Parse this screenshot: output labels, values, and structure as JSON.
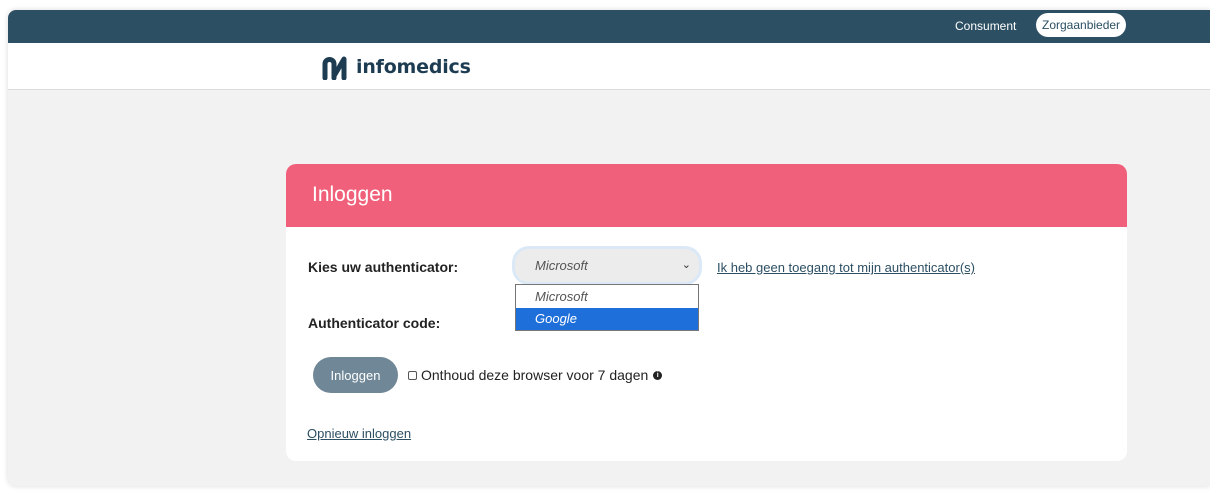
{
  "topnav": {
    "consumer": "Consument",
    "provider": "Zorgaanbieder"
  },
  "brand": {
    "name": "infomedics",
    "color": "#1d3c52"
  },
  "colors": {
    "topbar": "#2c4f63",
    "card_header": "#f0607a",
    "button": "#6f8797",
    "selected_option": "#1e6fd9"
  },
  "login": {
    "title": "Inloggen",
    "authenticator_label": "Kies uw authenticator:",
    "authenticator_selected": "Microsoft",
    "authenticator_options": [
      "Microsoft",
      "Google"
    ],
    "highlighted_option": "Google",
    "no_access_link": "Ik heb geen toegang tot mijn authenticator(s)",
    "code_label": "Authenticator code:",
    "submit_label": "Inloggen",
    "remember_label": "Onthoud deze browser voor 7 dagen",
    "remember_checked": false,
    "relogin_link": "Opnieuw inloggen"
  }
}
